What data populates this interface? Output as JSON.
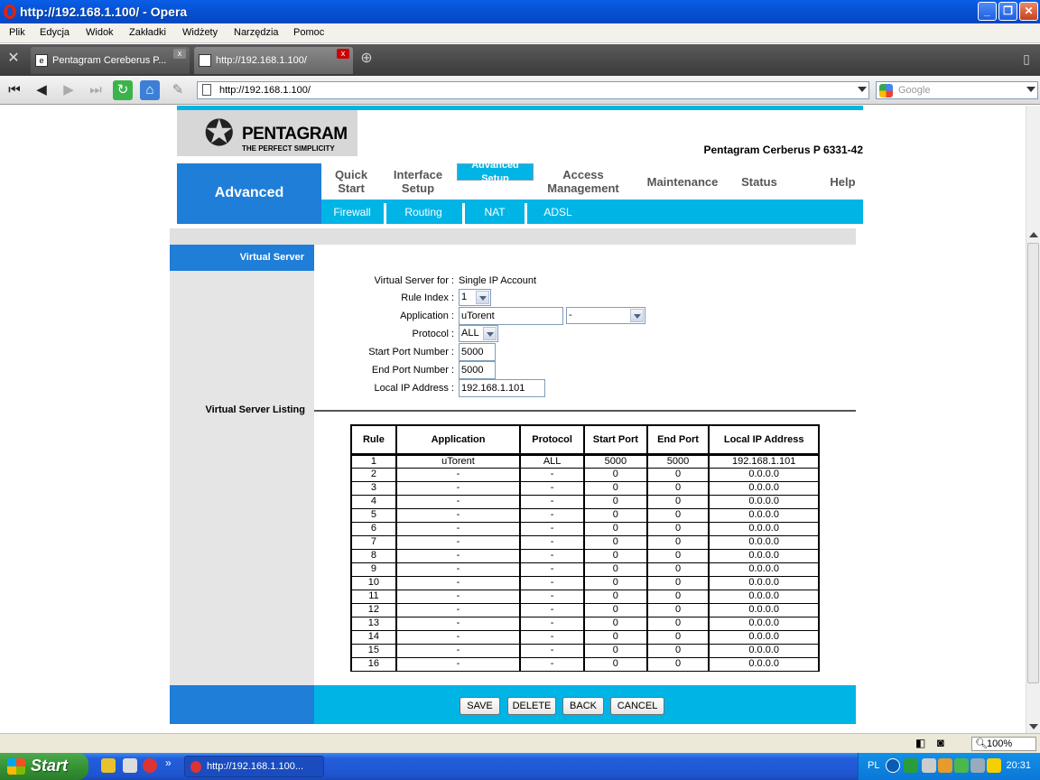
{
  "window": {
    "title": "http://192.168.1.100/ - Opera",
    "min_glyph": "_",
    "max_glyph": "❐",
    "close_glyph": "✕"
  },
  "menu": [
    "Plik",
    "Edycja",
    "Widok",
    "Zakładki",
    "Widżety",
    "Narzędzia",
    "Pomoc"
  ],
  "tabs": [
    {
      "label": "Pentagram Cereberus P..."
    },
    {
      "label": "http://192.168.1.100/"
    }
  ],
  "tab_close": "x",
  "address": {
    "url": "http://192.168.1.100/",
    "search_placeholder": "Google"
  },
  "router": {
    "brand": "PENTAGRAM",
    "tagline": "THE PERFECT SIMPLICITY",
    "model": "Pentagram Cerberus P 6331-42",
    "section": "Advanced",
    "nav": [
      {
        "l1": "Quick",
        "l2": "Start"
      },
      {
        "l1": "Interface",
        "l2": "Setup"
      },
      {
        "l1": "Advanced",
        "l2": "Setup"
      },
      {
        "l1": "Access",
        "l2": "Management"
      },
      {
        "l1": "Maintenance",
        "l2": ""
      },
      {
        "l1": "Status",
        "l2": ""
      },
      {
        "l1": "Help",
        "l2": ""
      }
    ],
    "subnav": [
      "Firewall",
      "Routing",
      "NAT",
      "ADSL"
    ],
    "panel_title": "Virtual Server",
    "form": {
      "vs_for_label": "Virtual Server for :",
      "vs_for_value": "Single IP Account",
      "rule_index_label": "Rule Index :",
      "rule_index_value": "1",
      "application_label": "Application :",
      "application_value": "uTorent",
      "application_preset": "-",
      "protocol_label": "Protocol :",
      "protocol_value": "ALL",
      "start_port_label": "Start Port Number :",
      "start_port_value": "5000",
      "end_port_label": "End Port Number :",
      "end_port_value": "5000",
      "local_ip_label": "Local IP Address :",
      "local_ip_value": "192.168.1.101"
    },
    "listing_title": "Virtual Server Listing",
    "table": {
      "headers": [
        "Rule",
        "Application",
        "Protocol",
        "Start Port",
        "End Port",
        "Local IP Address"
      ],
      "rows": [
        [
          "1",
          "uTorent",
          "ALL",
          "5000",
          "5000",
          "192.168.1.101"
        ],
        [
          "2",
          "-",
          "-",
          "0",
          "0",
          "0.0.0.0"
        ],
        [
          "3",
          "-",
          "-",
          "0",
          "0",
          "0.0.0.0"
        ],
        [
          "4",
          "-",
          "-",
          "0",
          "0",
          "0.0.0.0"
        ],
        [
          "5",
          "-",
          "-",
          "0",
          "0",
          "0.0.0.0"
        ],
        [
          "6",
          "-",
          "-",
          "0",
          "0",
          "0.0.0.0"
        ],
        [
          "7",
          "-",
          "-",
          "0",
          "0",
          "0.0.0.0"
        ],
        [
          "8",
          "-",
          "-",
          "0",
          "0",
          "0.0.0.0"
        ],
        [
          "9",
          "-",
          "-",
          "0",
          "0",
          "0.0.0.0"
        ],
        [
          "10",
          "-",
          "-",
          "0",
          "0",
          "0.0.0.0"
        ],
        [
          "11",
          "-",
          "-",
          "0",
          "0",
          "0.0.0.0"
        ],
        [
          "12",
          "-",
          "-",
          "0",
          "0",
          "0.0.0.0"
        ],
        [
          "13",
          "-",
          "-",
          "0",
          "0",
          "0.0.0.0"
        ],
        [
          "14",
          "-",
          "-",
          "0",
          "0",
          "0.0.0.0"
        ],
        [
          "15",
          "-",
          "-",
          "0",
          "0",
          "0.0.0.0"
        ],
        [
          "16",
          "-",
          "-",
          "0",
          "0",
          "0.0.0.0"
        ]
      ]
    },
    "buttons": {
      "save": "SAVE",
      "delete": "DELETE",
      "back": "BACK",
      "cancel": "CANCEL"
    }
  },
  "statusbar": {
    "zoom": "100%"
  },
  "taskbar": {
    "start": "Start",
    "chevron": "»",
    "task": "http://192.168.1.100...",
    "lang": "PL",
    "clock": "20:31"
  },
  "colors": {
    "router_blue": "#1e7ed8",
    "router_cyan": "#00b4e6",
    "xp_title": "#0653d6"
  }
}
